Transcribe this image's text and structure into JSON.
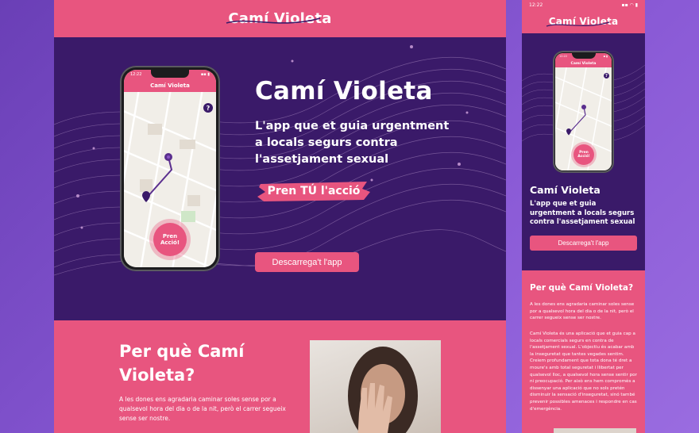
{
  "brand": {
    "logo_text": "Camí Violeta"
  },
  "colors": {
    "pink": "#e8557f",
    "purple": "#3a1a69",
    "backdrop": "#7a4ccc"
  },
  "desktop": {
    "hero": {
      "title": "Camí Violeta",
      "subtitle": "L'app que et guia urgentment a locals segurs contra l'assetjament sexual",
      "cta_brush": "Pren TÚ l'acció",
      "download_label": "Descarrega't l'app"
    },
    "phone": {
      "time": "12:22",
      "app_title": "Camí Violeta",
      "help_symbol": "?",
      "pren_button": "Pren Acció!"
    },
    "why": {
      "heading": "Per què Camí Violeta?",
      "paragraph": "A les dones ens agradaria caminar soles sense por a qualsevol hora del dia o de la nit, però el carrer segueix sense ser nostre."
    }
  },
  "mobile": {
    "status_time": "12:22",
    "phone": {
      "time": "12:22",
      "app_title": "Camí Violeta",
      "help_symbol": "?",
      "pren_button": "Pren Acció!"
    },
    "hero": {
      "title": "Camí Violeta",
      "subtitle": "L'app que et guia urgentment a locals segurs contra l'assetjament sexual",
      "download_label": "Descarrega't l'app"
    },
    "why": {
      "heading": "Per què Camí Violeta?",
      "paragraph1": "A les dones ens agradaria caminar soles sense por a qualsevol hora del dia o de la nit, però el carrer segueix sense ser nostre.",
      "paragraph2": "Camí Violeta és una aplicació que et guia cap a locals comercials segurs en contra de l'assetjament sexual. L'objectiu és acabar amb la inseguretat que tantes vegades sentim. Creiem profundament que tota dona té dret a moure's amb total seguretat i llibertat per qualsevol lloc, a qualsevol hora sense sentir por ni preocupació. Per això ens hem compromès a dissenyar una aplicació que no sols pretén disminuir la sensació d'inseguretat, sinó també prevenir possibles amenaces i respondre en cas d'emergència."
    }
  }
}
